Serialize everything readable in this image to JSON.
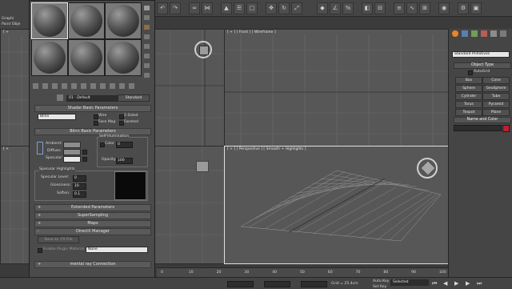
{
  "toolbar": {
    "left_labels": [
      "Graphi",
      "Paint Obje"
    ],
    "icons": [
      "undo-icon",
      "redo-icon",
      "link-icon",
      "unlink-icon",
      "select-icon",
      "select-by-name-icon",
      "region-select-icon",
      "move-icon",
      "rotate-icon",
      "scale-icon",
      "snap-icon",
      "angle-snap-icon",
      "percent-snap-icon",
      "mirror-icon",
      "align-icon",
      "layer-icon",
      "curve-editor-icon",
      "schematic-icon",
      "material-editor-icon",
      "render-setup-icon",
      "render-icon"
    ]
  },
  "viewports": {
    "front": {
      "label": "[ + ] [ Front ] [ Wireframe ]"
    },
    "perspective": {
      "label": "[ + ] [ Perspective ] [ Smooth + Highlights ]"
    },
    "top_left_marker": "[ +",
    "bottom_left_marker": "[ +"
  },
  "material_editor": {
    "material_name": "01 - Default",
    "material_type": "Standard",
    "rollouts": {
      "shader_basic": "Shader Basic Parameters",
      "blinn_basic": "Blinn Basic Parameters",
      "extended": "Extended Parameters",
      "supersampling": "SuperSampling",
      "maps": "Maps",
      "directx": "DirectX Manager",
      "mental_ray": "mental ray Connection"
    },
    "shader": {
      "value": "Blinn",
      "wire": "Wire",
      "two_sided": "2-Sided",
      "face_map": "Face Map",
      "faceted": "Faceted"
    },
    "blinn": {
      "ambient": "Ambient:",
      "diffuse": "Diffuse:",
      "specular": "Specular:",
      "self_illumination": "Self-Illumination",
      "color": "Color",
      "color_value": "0",
      "opacity": "Opacity:",
      "opacity_value": "100",
      "specular_highlights": "Specular Highlights",
      "specular_level": "Specular Level:",
      "specular_level_value": "0",
      "glossiness": "Glossiness:",
      "glossiness_value": "10",
      "soften": "Soften:",
      "soften_value": "0.1"
    },
    "directx": {
      "save_button": "Save as .FX File",
      "enable_plugin": "Enable Plugin Material",
      "plugin_value": "None"
    }
  },
  "command_panel": {
    "category": "Standard Primitives",
    "object_type": "Object Type",
    "autogrid": "AutoGrid",
    "buttons": [
      [
        "Box",
        "Cone"
      ],
      [
        "Sphere",
        "GeoSphere"
      ],
      [
        "Cylinder",
        "Tube"
      ],
      [
        "Torus",
        "Pyramid"
      ],
      [
        "Teapot",
        "Plane"
      ]
    ],
    "name_and_color": "Name and Color",
    "color": "#c0202e"
  },
  "timeline": {
    "ticks": [
      "0",
      "10",
      "20",
      "30",
      "40",
      "50",
      "60",
      "70",
      "80",
      "90",
      "100"
    ]
  },
  "status_bar": {
    "coord_readout": "Grid = 25.4cm",
    "auto_key": "Auto Key",
    "selected": "Selected",
    "set_key": "Set Key"
  },
  "colors": {
    "viewport_bg": "#575757",
    "grid": "#6a6a6a",
    "panel_bg": "#4b4b4b",
    "object_color": "#c0202e"
  }
}
